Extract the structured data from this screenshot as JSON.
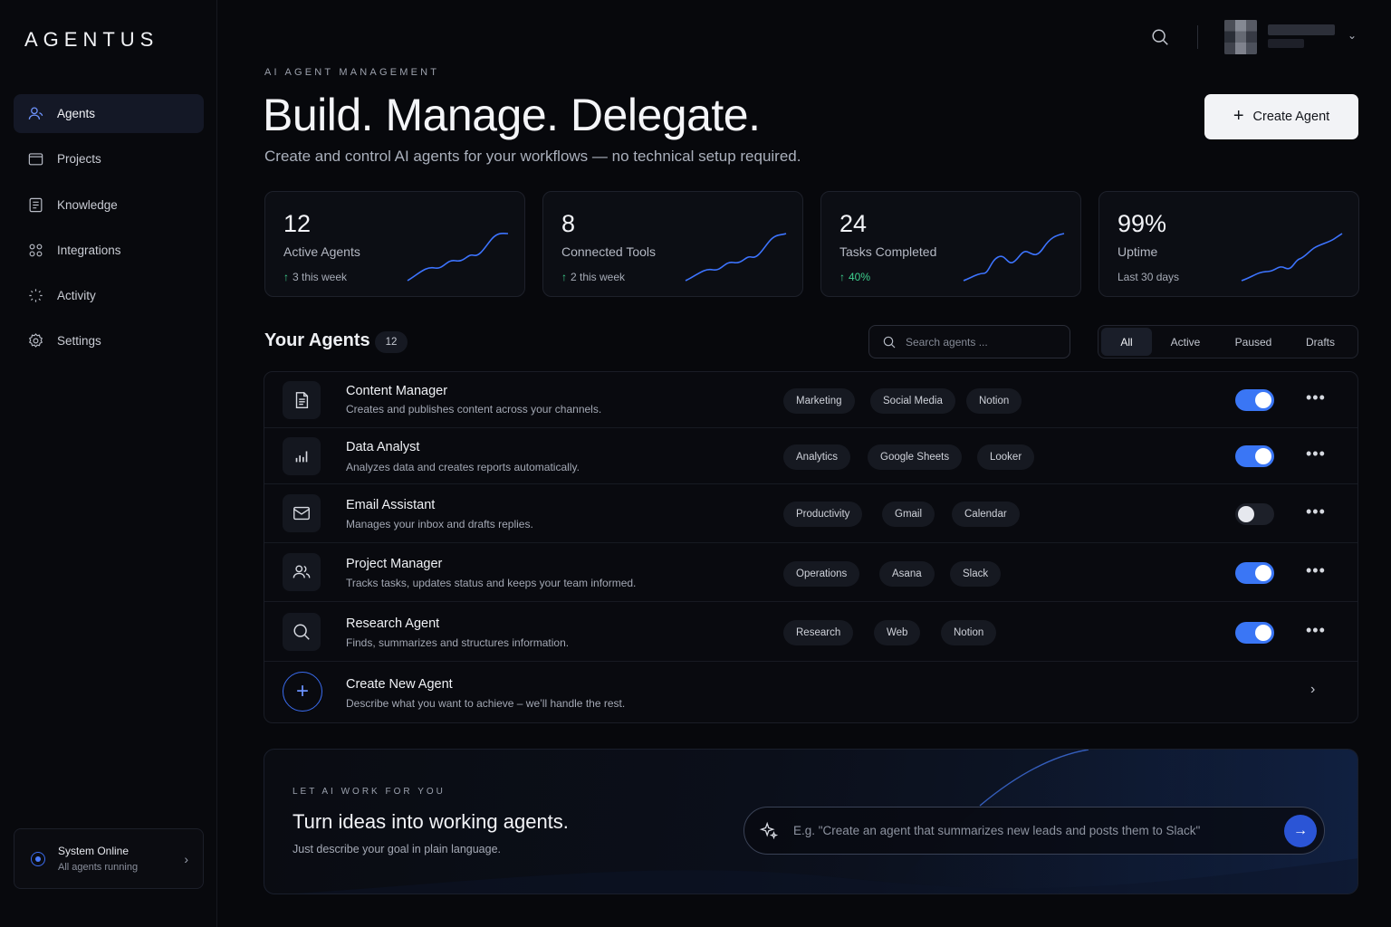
{
  "brand": "AGENTUS",
  "nav": [
    {
      "label": "Agents",
      "icon": "user-icon",
      "active": true
    },
    {
      "label": "Projects",
      "icon": "folder-icon",
      "active": false
    },
    {
      "label": "Knowledge",
      "icon": "book-icon",
      "active": false
    },
    {
      "label": "Integrations",
      "icon": "grid-icon",
      "active": false
    },
    {
      "label": "Activity",
      "icon": "activity-icon",
      "active": false
    },
    {
      "label": "Settings",
      "icon": "gear-icon",
      "active": false
    }
  ],
  "system_status": {
    "title": "System Online",
    "subtitle": "All agents running"
  },
  "header": {
    "eyebrow": "AI AGENT MANAGEMENT",
    "title": "Build. Manage. Delegate.",
    "subtitle": "Create and control AI agents for your workflows — no technical setup required.",
    "create_button": "Create Agent"
  },
  "stats": [
    {
      "value": "12",
      "label": "Active Agents",
      "arrow": "↑",
      "sub": "3 this week"
    },
    {
      "value": "8",
      "label": "Connected Tools",
      "arrow": "↑",
      "sub": "2 this week"
    },
    {
      "value": "24",
      "label": "Tasks Completed",
      "arrow": "↑",
      "sub": "40%"
    },
    {
      "value": "99%",
      "label": "Uptime",
      "arrow": "",
      "sub": "Last 30 days"
    }
  ],
  "agents_section": {
    "title": "Your Agents",
    "count": "12",
    "search_placeholder": "Search agents ...",
    "filters": [
      "All",
      "Active",
      "Paused",
      "Drafts"
    ],
    "active_filter": "All"
  },
  "agents": [
    {
      "name": "Content Manager",
      "description": "Creates and publishes content across your channels.",
      "icon": "document-icon",
      "tags": [
        "Marketing",
        "Social Media",
        "Notion"
      ],
      "enabled": true
    },
    {
      "name": "Data Analyst",
      "description": "Analyzes data and creates reports automatically.",
      "icon": "bar-chart-icon",
      "tags": [
        "Analytics",
        "Google Sheets",
        "Looker"
      ],
      "enabled": true
    },
    {
      "name": "Email Assistant",
      "description": "Manages your inbox and drafts replies.",
      "icon": "mail-icon",
      "tags": [
        "Productivity",
        "Gmail",
        "Calendar"
      ],
      "enabled": false
    },
    {
      "name": "Project Manager",
      "description": "Tracks tasks, updates status and keeps your team informed.",
      "icon": "users-icon",
      "tags": [
        "Operations",
        "Asana",
        "Slack"
      ],
      "enabled": true
    },
    {
      "name": "Research Agent",
      "description": "Finds, summarizes and structures information.",
      "icon": "search-icon",
      "tags": [
        "Research",
        "Web",
        "Notion"
      ],
      "enabled": true
    }
  ],
  "create_new": {
    "title": "Create New Agent",
    "description": "Describe what you want to achieve – we’ll handle the rest."
  },
  "banner": {
    "eyebrow": "LET AI WORK FOR YOU",
    "title": "Turn ideas into working agents.",
    "subtitle": "Just describe your goal in plain language.",
    "placeholder": "E.g. \"Create an agent that summarizes new leads and posts them to Slack\""
  },
  "colors": {
    "accent": "#3a76f5",
    "success": "#3ecf8e",
    "background": "#07080c"
  }
}
